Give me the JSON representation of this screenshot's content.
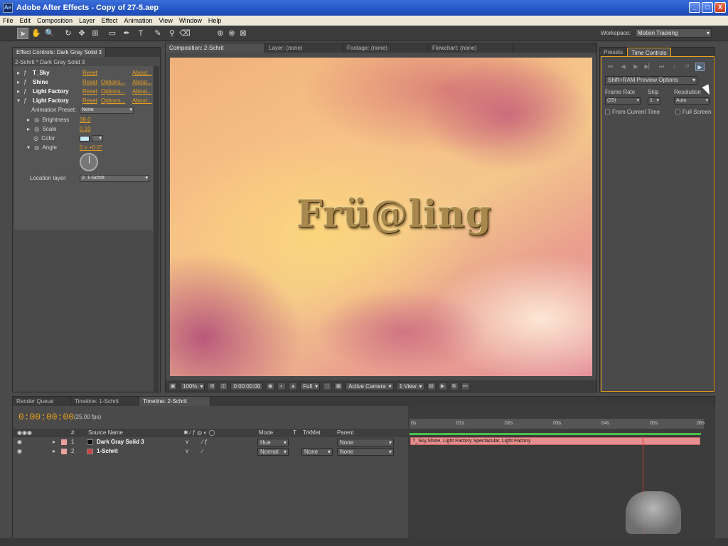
{
  "window": {
    "title": "Adobe After Effects - Copy of 27-5.aep",
    "controls": [
      "_",
      "□",
      "X"
    ]
  },
  "menu": [
    "File",
    "Edit",
    "Composition",
    "Layer",
    "Effect",
    "Animation",
    "View",
    "Window",
    "Help"
  ],
  "workspace": {
    "label": "Workspace:",
    "value": "Motion Tracking"
  },
  "effect_controls": {
    "tab": "Effect Controls: Dark Gray Solid 3",
    "subtitle": "2-Schrit * Dark Gray Solid 3",
    "effects": [
      {
        "name": "T_Sky",
        "reset": "Reset",
        "options": "",
        "about": "About..."
      },
      {
        "name": "Shine",
        "reset": "Reset",
        "options": "Options...",
        "about": "About..."
      },
      {
        "name": "Light Factory",
        "reset": "Reset",
        "options": "Options...",
        "about": "About..."
      },
      {
        "name": "Light Factory",
        "reset": "Reset",
        "options": "Options...",
        "about": "About..."
      }
    ],
    "animation_preset_label": "Animation Preset:",
    "animation_preset_value": "None",
    "brightness_label": "Brightness",
    "brightness_value": "38.0",
    "scale_label": "Scale",
    "scale_value": "0.10",
    "color_label": "Color",
    "angle_label": "Angle",
    "angle_value": "0 x +0.0°",
    "location_layer_label": "Location layer:",
    "location_layer_value": "2. 1-Schrit"
  },
  "composition": {
    "tabs": [
      "Composition: 2-Schrit",
      "Layer: (none)",
      "Footage: (none)",
      "Flowchart: (none)"
    ],
    "viewer_text": "Frü@ling",
    "zoom": "100%",
    "timecode": "0:00:00:00",
    "resolution": "Full",
    "camera": "Active Camera",
    "views": "1 View"
  },
  "time_controls": {
    "tabs": [
      "Presets",
      "Time Controls"
    ],
    "preview_options": "Shift+RAM Preview Options",
    "frame_rate_label": "Frame Rate",
    "frame_rate_value": "(25)",
    "skip_label": "Skip",
    "skip_value": "1",
    "resolution_label": "Resolution",
    "resolution_value": "Auto",
    "from_current_time": "From Current Time",
    "full_screen": "Full Screen"
  },
  "timeline": {
    "tabs": [
      "Render Queue",
      "Timeline: 1-Schrit",
      "Timeline: 2-Schrit"
    ],
    "current_time": "0:00:00:00",
    "fps": "(25.00 fps)",
    "headers": {
      "num": "#",
      "source": "Source Name",
      "mode": "Mode",
      "t": "T",
      "trkmat": "TrkMat",
      "parent": "Parent"
    },
    "layers": [
      {
        "num": "1",
        "name": "Dark Gray Solid 3",
        "mode": "Hue",
        "trkmat": "",
        "parent": "None",
        "swatch": "#111111",
        "label": "#e8a0a0"
      },
      {
        "num": "2",
        "name": "1-Schrit",
        "mode": "Normal",
        "trkmat": "None",
        "parent": "None",
        "swatch": "#d04040",
        "label": "#e8a0a0"
      }
    ],
    "ruler_ticks": [
      "0s",
      "01s",
      "02s",
      "03s",
      "04s",
      "05s",
      "06s"
    ],
    "layer_bar_text": "T_Sky,Shine, Light Factory Spectacular, Light Factory"
  },
  "colors": {
    "accent": "#e8a020",
    "titlebar": "#2556c8",
    "panel": "#4a4a4a",
    "layer_bar": "#e89090"
  }
}
